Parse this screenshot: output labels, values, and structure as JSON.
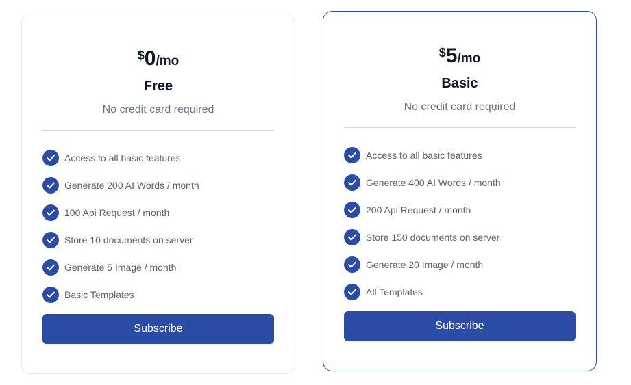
{
  "colors": {
    "accent": "#2b4ca6",
    "muted_text": "#6b7280",
    "border": "#e5e7eb"
  },
  "plans": [
    {
      "currency": "$",
      "amount": "0",
      "period": "/mo",
      "name": "Free",
      "subtitle": "No credit card required",
      "features": [
        "Access to all basic features",
        "Generate 200 AI Words / month",
        "100 Api Request / month",
        "Store 10 documents on server",
        "Generate 5 Image / month",
        "Basic Templates"
      ],
      "button_label": "Subscribe",
      "highlighted": false
    },
    {
      "currency": "$",
      "amount": "5",
      "period": "/mo",
      "name": "Basic",
      "subtitle": "No credit card required",
      "features": [
        "Access to all basic features",
        "Generate 400 AI Words / month",
        "200 Api Request / month",
        "Store 150 documents on server",
        "Generate 20 Image / month",
        "All Templates"
      ],
      "button_label": "Subscribe",
      "highlighted": true
    }
  ],
  "icons": {
    "feature_check": "check-circle-icon"
  }
}
